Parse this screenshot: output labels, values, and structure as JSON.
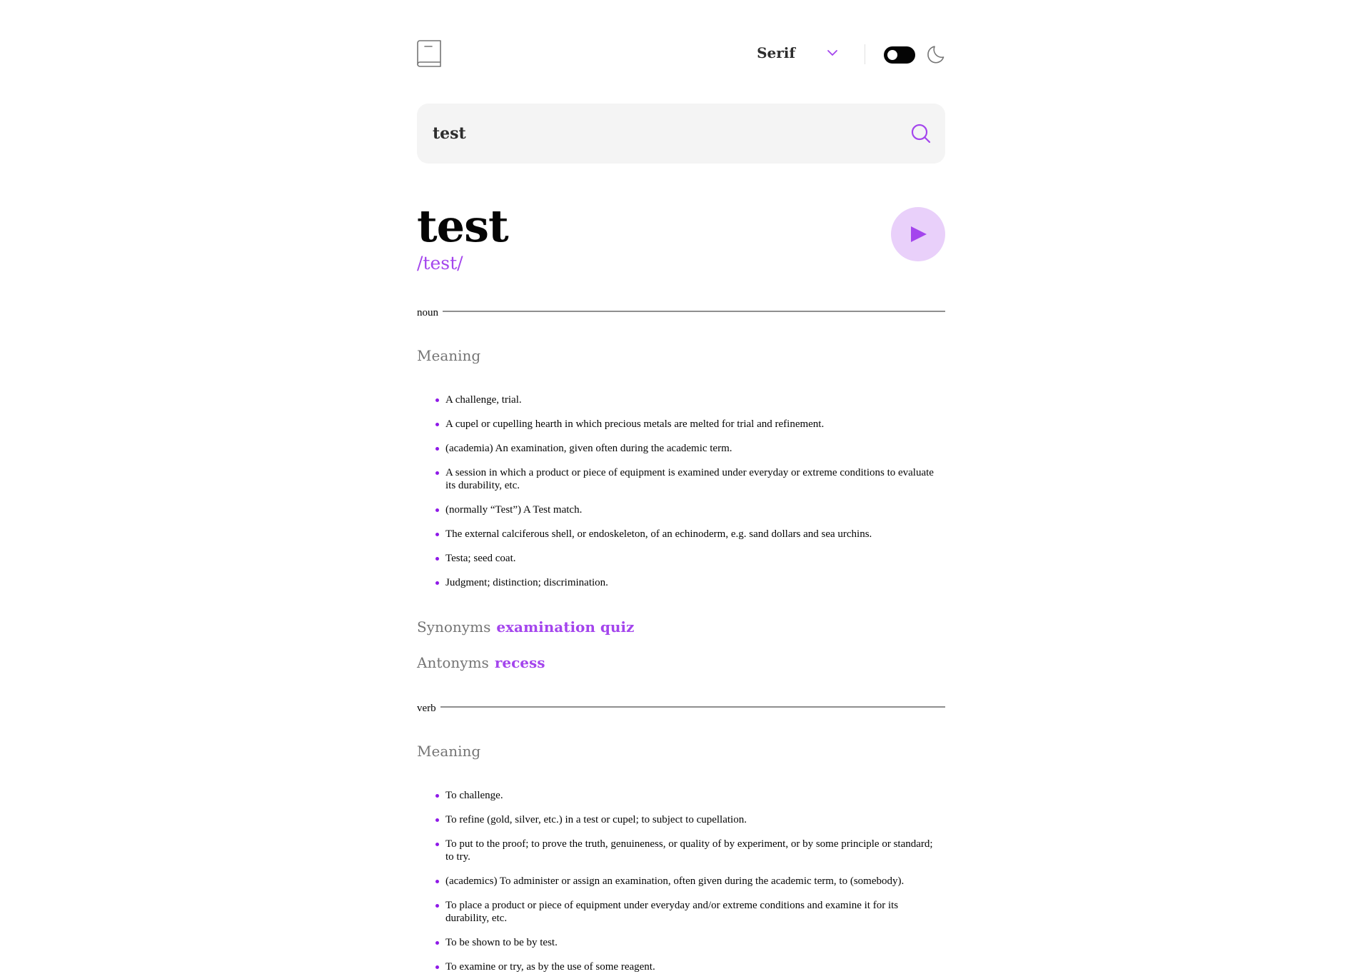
{
  "header": {
    "logo_icon": "book-icon",
    "font_selected": "Serif",
    "dropdown_icon": "chevron-down-icon",
    "theme_icon": "moon-icon"
  },
  "search": {
    "value": "test",
    "icon": "search-icon"
  },
  "entry": {
    "word": "test",
    "phonetic": "/test/",
    "play_icon": "play-icon"
  },
  "sections": [
    {
      "part_of_speech": "noun",
      "meaning_heading": "Meaning",
      "definitions": [
        "A challenge, trial.",
        "A cupel or cupelling hearth in which precious metals are melted for trial and refinement.",
        "(academia) An examination, given often during the academic term.",
        "A session in which a product or piece of equipment is examined under everyday or extreme conditions to evaluate its durability, etc.",
        "(normally “Test”) A Test match.",
        "The external calciferous shell, or endoskeleton, of an echinoderm, e.g. sand dollars and sea urchins.",
        "Testa; seed coat.",
        "Judgment; distinction; discrimination."
      ],
      "synonyms_label": "Synonyms",
      "synonyms": "examination quiz",
      "antonyms_label": "Antonyms",
      "antonyms": "recess"
    },
    {
      "part_of_speech": "verb",
      "meaning_heading": "Meaning",
      "definitions": [
        "To challenge.",
        "To refine (gold, silver, etc.) in a test or cupel; to subject to cupellation.",
        "To put to the proof; to prove the truth, genuineness, or quality of by experiment, or by some principle or standard; to try.",
        "(academics) To administer or assign an examination, often given during the academic term, to (somebody).",
        "To place a product or piece of equipment under everyday and/or extreme conditions and examine it for its durability, etc.",
        "To be shown to be by test.",
        "To examine or try, as by the use of some reagent."
      ]
    }
  ],
  "colors": {
    "accent": "#a445ed",
    "bullet": "#8f19e8",
    "play_bg": "#e9d0fa",
    "muted": "#757575",
    "search_bg": "#f4f4f4"
  }
}
